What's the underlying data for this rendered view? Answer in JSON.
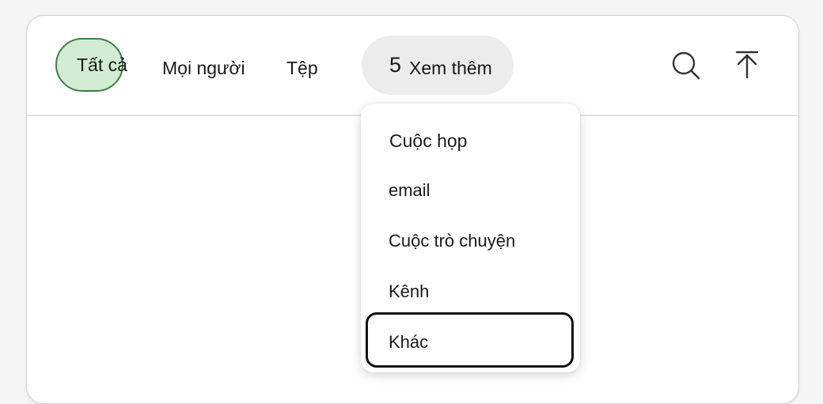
{
  "tabs": {
    "all": "Tất cả",
    "people": "Mọi người",
    "files": "Tệp",
    "more_count": "5",
    "more_label": "Xem thêm"
  },
  "icons": {
    "search": "search-icon",
    "scroll_top": "arrow-up-to-line-icon"
  },
  "more_menu": {
    "items": [
      "Cuộc họp",
      "email",
      "Cuộc trò chuyện",
      "Kênh",
      "Khác"
    ],
    "focused_index": 4
  },
  "colors": {
    "selected_tab_fill": "#d2ebd3",
    "selected_tab_border": "#3f7f44",
    "more_tab_fill": "#ececec",
    "focus_ring": "#111111"
  }
}
